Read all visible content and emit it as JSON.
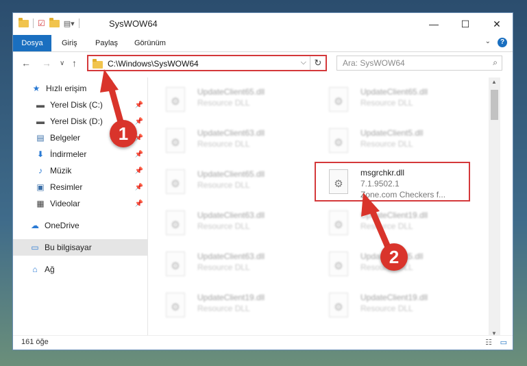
{
  "window": {
    "title": "SysWOW64",
    "controls": {
      "minimize": "—",
      "maximize": "☐",
      "close": "✕"
    }
  },
  "ribbon": {
    "tabs": [
      "Dosya",
      "Giriş",
      "Paylaş",
      "Görünüm"
    ],
    "help": "?"
  },
  "navigation": {
    "back": "←",
    "forward": "→",
    "recent": "∨",
    "up": "↑",
    "address_path": "C:\\Windows\\SysWOW64",
    "search_placeholder": "Ara: SysWOW64"
  },
  "nav_pane": {
    "items": [
      {
        "label": "Hızlı erişim",
        "icon": "star-icon",
        "pinned": false
      },
      {
        "label": "Yerel Disk (C:)",
        "icon": "drive-icon",
        "pinned": true
      },
      {
        "label": "Yerel Disk (D:)",
        "icon": "drive-icon",
        "pinned": true
      },
      {
        "label": "Belgeler",
        "icon": "documents-icon",
        "pinned": true
      },
      {
        "label": "İndirmeler",
        "icon": "download-icon",
        "pinned": true
      },
      {
        "label": "Müzik",
        "icon": "music-icon",
        "pinned": true
      },
      {
        "label": "Resimler",
        "icon": "pictures-icon",
        "pinned": true
      },
      {
        "label": "Videolar",
        "icon": "video-icon",
        "pinned": true
      },
      {
        "label": "OneDrive",
        "icon": "cloud-icon",
        "pinned": false
      },
      {
        "label": "Bu bilgisayar",
        "icon": "computer-icon",
        "pinned": false,
        "selected": true
      },
      {
        "label": "Ağ",
        "icon": "network-icon",
        "pinned": false
      }
    ]
  },
  "files": [
    {
      "name": "UpdateClient65.dll",
      "type": "Resource DLL",
      "blurred": true
    },
    {
      "name": "UpdateClient65.dll",
      "type": "Resource DLL",
      "blurred": true
    },
    {
      "name": "UpdateClient63.dll",
      "type": "Resource DLL",
      "blurred": true
    },
    {
      "name": "UpdateClient5.dll",
      "type": "Resource DLL",
      "blurred": true
    },
    {
      "name": "UpdateClient65.dll",
      "type": "Resource DLL",
      "blurred": true
    },
    {
      "name": "msgrchkr.dll",
      "version": "7.1.9502.1",
      "description": "Zone.com Checkers f...",
      "blurred": false,
      "highlighted": true
    },
    {
      "name": "UpdateClient63.dll",
      "type": "Resource DLL",
      "blurred": true
    },
    {
      "name": "UpdateClient19.dll",
      "type": "Resource DLL",
      "blurred": true
    },
    {
      "name": "UpdateClient63.dll",
      "type": "Resource DLL",
      "blurred": true
    },
    {
      "name": "UpdateClient5.dll",
      "type": "Resource DLL",
      "blurred": true
    },
    {
      "name": "UpdateClient19.dll",
      "type": "Resource DLL",
      "blurred": true
    },
    {
      "name": "UpdateClient19.dll",
      "type": "Resource DLL",
      "blurred": true
    }
  ],
  "status": {
    "item_count": "161 öğe"
  },
  "annotations": {
    "step1": "1",
    "step2": "2",
    "color": "#d9342b"
  }
}
